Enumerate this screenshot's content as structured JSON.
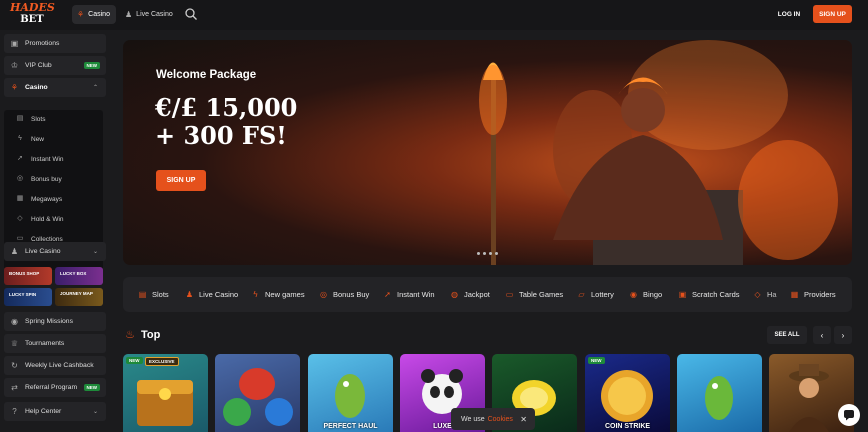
{
  "brand": {
    "logo_line1": "HADES",
    "logo_line2": "BET",
    "accent": "#e5511c"
  },
  "topnav": {
    "casino": "Casino",
    "live_casino": "Live Casino",
    "login": "LOG IN",
    "signup": "SIGN UP"
  },
  "sidebar": {
    "promotions": "Promotions",
    "vip_club": "VIP Club",
    "vip_badge": "NEW",
    "casino": "Casino",
    "casino_items": [
      "Slots",
      "New",
      "Instant Win",
      "Bonus buy",
      "Megaways",
      "Hold & Win",
      "Collections"
    ],
    "live_casino": "Live Casino",
    "tiles": [
      "BONUS SHOP",
      "LUCKY BOX",
      "LUCKY SPIN",
      "JOURNEY MAP"
    ],
    "spring_missions": "Spring Missions",
    "tournaments": "Tournaments",
    "weekly_cashback": "Weekly Live Cashback",
    "referral": "Referral Program",
    "referral_badge": "NEW",
    "help_center": "Help Center"
  },
  "hero": {
    "title": "Welcome Package",
    "amount_line1": "€/£ 15,000",
    "amount_line2": "+ 300 FS!",
    "cta": "SIGN UP",
    "slide_count": 4
  },
  "categories": [
    "Slots",
    "Live Casino",
    "New games",
    "Bonus Buy",
    "Instant Win",
    "Jackpot",
    "Table Games",
    "Lottery",
    "Bingo",
    "Scratch Cards",
    "Ha",
    "Providers"
  ],
  "top": {
    "title": "Top",
    "see_all": "SEE ALL"
  },
  "games": [
    {
      "tag1": "NEW",
      "tag2": "EXCLUSIVE",
      "name": ""
    },
    {
      "name": ""
    },
    {
      "name": "PERFECT HAUL"
    },
    {
      "name": "LUXE"
    },
    {
      "name": ""
    },
    {
      "tag1": "NEW",
      "name": "COIN STRIKE"
    },
    {
      "name": ""
    },
    {
      "name": ""
    }
  ],
  "cookie": {
    "text": "We use",
    "link": "Cookies",
    "close": "✕"
  }
}
